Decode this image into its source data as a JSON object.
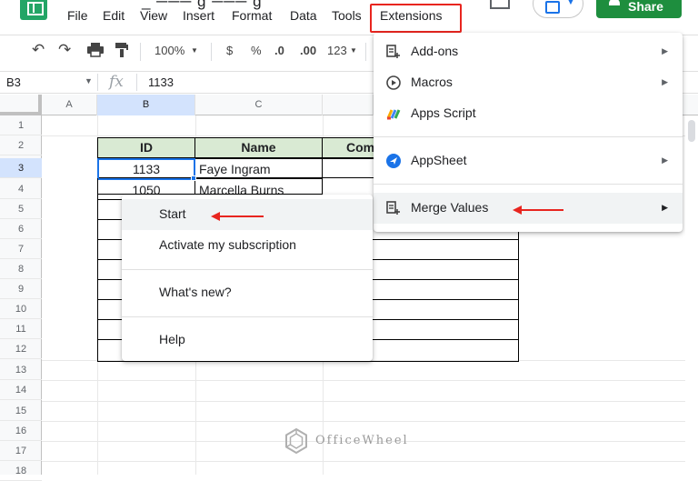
{
  "menubar": {
    "items": [
      "File",
      "Edit",
      "View",
      "Insert",
      "Format",
      "Data",
      "Tools"
    ],
    "extensions": "Extensions",
    "share": "Share",
    "title_fragment": "_ ─── g ─── g"
  },
  "toolbar": {
    "zoom": "100%",
    "currency": "$",
    "percent": "%",
    "dec_decrease": ".0",
    "dec_increase": ".00",
    "format_more": "123"
  },
  "formula": {
    "cell_ref": "B3",
    "fx": "fx",
    "value": "1133"
  },
  "columns": [
    "A",
    "B",
    "C"
  ],
  "rows": [
    "1",
    "2",
    "3",
    "4",
    "5",
    "6",
    "7",
    "8",
    "9",
    "10",
    "11",
    "12",
    "13",
    "14",
    "15",
    "16",
    "17",
    "18"
  ],
  "table": {
    "headers": [
      "ID",
      "Name",
      "Com"
    ],
    "rows": [
      {
        "id": "1133",
        "name": "Faye Ingram"
      },
      {
        "id": "1050",
        "name": "Marcella Burns"
      }
    ]
  },
  "extensions_menu": {
    "items": [
      {
        "label": "Add-ons",
        "icon": "addons-icon"
      },
      {
        "label": "Macros",
        "icon": "macros-icon"
      },
      {
        "label": "Apps Script",
        "icon": "apps-script-icon"
      },
      {
        "label": "AppSheet",
        "icon": "appsheet-icon"
      },
      {
        "label": "Merge Values",
        "icon": "merge-values-icon"
      }
    ]
  },
  "merge_submenu": {
    "items": [
      "Start",
      "Activate my subscription",
      "What's new?",
      "Help"
    ]
  },
  "watermark": "OfficeWheel",
  "colors": {
    "accent_red": "#e8251f",
    "header_green": "#d9ead3",
    "share_green": "#1e8e3e",
    "selection_blue": "#1a73e8"
  }
}
